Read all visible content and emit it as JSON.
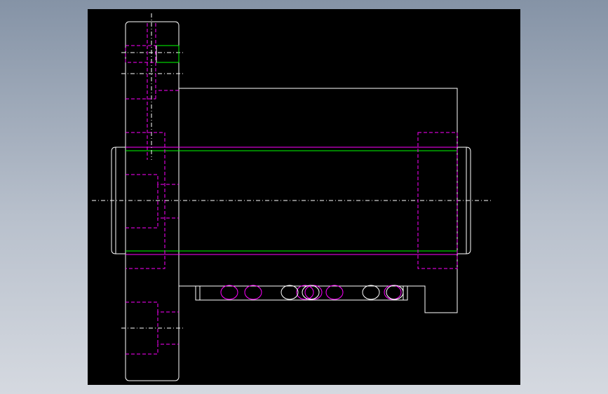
{
  "viewport": {
    "background": "#000000",
    "view": "front-section"
  },
  "colors": {
    "visible_edge": "#ffffff",
    "hidden_edge": "#ff00ff",
    "thread_line": "#00ff00",
    "center_line": "#ffffff",
    "page_background_top": "#8593a6",
    "page_background_bottom": "#d5d9e0"
  },
  "drawing": {
    "part": "ball-screw-nut-assembly",
    "features": [
      "flange",
      "nut-body",
      "screw-shaft",
      "ball-recirculation-channel",
      "mounting-bolt-holes",
      "shaft-end-left",
      "shaft-end-right"
    ],
    "ball_count": 10,
    "bolt_hole_count": 2
  }
}
